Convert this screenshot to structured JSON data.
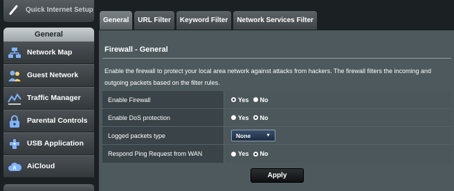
{
  "sidebar": {
    "quick_setup_label": "Quick Internet Setup",
    "section_title": "General",
    "items": [
      {
        "label": "Network Map",
        "icon": "network-map-icon"
      },
      {
        "label": "Guest Network",
        "icon": "guest-network-icon"
      },
      {
        "label": "Traffic Manager",
        "icon": "traffic-manager-icon"
      },
      {
        "label": "Parental Controls",
        "icon": "parental-controls-icon"
      },
      {
        "label": "USB Application",
        "icon": "usb-application-icon"
      },
      {
        "label": "AiCloud",
        "icon": "aicloud-icon"
      }
    ]
  },
  "tabs": [
    {
      "label": "General",
      "active": true
    },
    {
      "label": "URL Filter",
      "active": false
    },
    {
      "label": "Keyword Filter",
      "active": false
    },
    {
      "label": "Network Services Filter",
      "active": false
    }
  ],
  "panel": {
    "title": "Firewall - General",
    "description": "Enable the firewall to protect your local area network against attacks from hackers. The firewall filters the incoming and outgoing packets based on the filter rules."
  },
  "form": {
    "enable_firewall": {
      "label": "Enable Firewall",
      "yes": "Yes",
      "no": "No",
      "selected": "Yes"
    },
    "enable_dos": {
      "label": "Enable DoS protection",
      "yes": "Yes",
      "no": "No",
      "selected": "No"
    },
    "logged_packets": {
      "label": "Logged packets type",
      "value": "None"
    },
    "ping_wan": {
      "label": "Respond Ping Request from WAN",
      "yes": "Yes",
      "no": "No",
      "selected": "No"
    }
  },
  "apply_label": "Apply",
  "colors": {
    "accent": "#4d595d",
    "background": "#1b2023"
  }
}
